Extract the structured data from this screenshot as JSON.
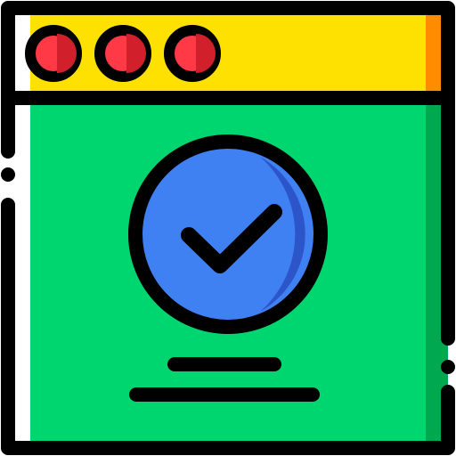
{
  "window": {
    "titlebar_color": "#FFE100",
    "titlebar_shadow": "#FF8C00",
    "content_color": "#00D66F",
    "content_shadow": "#00A84F",
    "outline_color": "#000000",
    "controls": [
      {
        "name": "close",
        "color": "#FF3A46",
        "shade": "#D1202C"
      },
      {
        "name": "minimize",
        "color": "#FF3A46",
        "shade": "#D1202C"
      },
      {
        "name": "maximize",
        "color": "#FF3A46",
        "shade": "#D1202C"
      }
    ]
  },
  "status": {
    "icon": "check-circle-icon",
    "circle_color": "#3F80F2",
    "circle_shade": "#2C55C9"
  }
}
